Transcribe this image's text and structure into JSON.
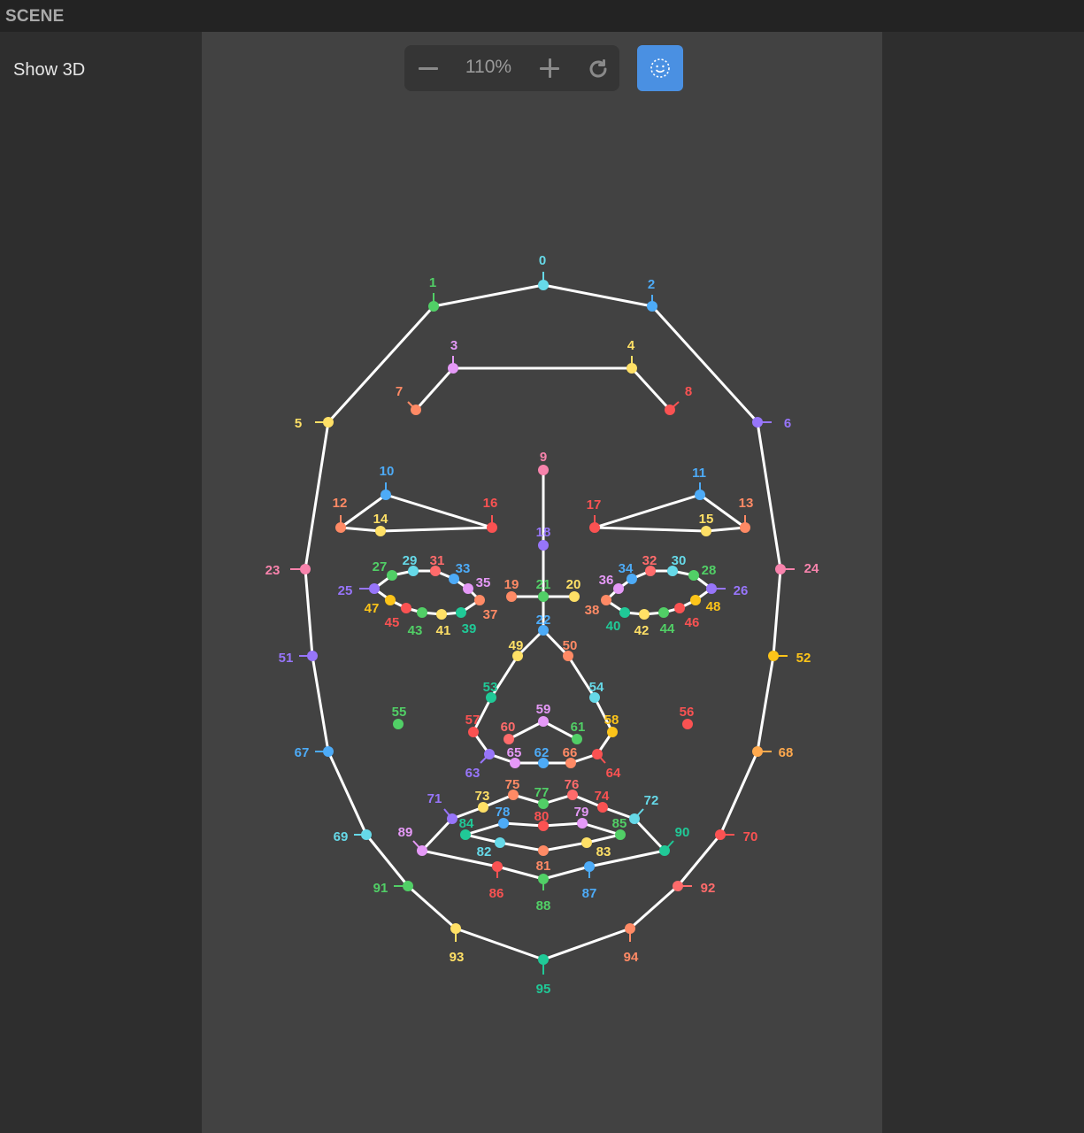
{
  "header": {
    "title": "SCENE"
  },
  "sidebar": {
    "toggle_label": "Show 3D"
  },
  "toolbar": {
    "zoom_value": "110%",
    "zoom_out_icon": "minus-icon",
    "zoom_in_icon": "plus-icon",
    "reset_icon": "rotate-icon",
    "face_button_icon": "face-dotted-icon",
    "face_button_color": "#4a90e2"
  },
  "landmarks": {
    "line_color": "#ffffff",
    "points": [
      {
        "id": "0",
        "c": "#66d9e8"
      },
      {
        "id": "1",
        "c": "#51cf66"
      },
      {
        "id": "2",
        "c": "#4dabf7"
      },
      {
        "id": "3",
        "c": "#e599f7"
      },
      {
        "id": "4",
        "c": "#ffe066"
      },
      {
        "id": "5",
        "c": "#ffe066"
      },
      {
        "id": "6",
        "c": "#9775fa"
      },
      {
        "id": "7",
        "c": "#ff8a65"
      },
      {
        "id": "8",
        "c": "#fa5252"
      },
      {
        "id": "9",
        "c": "#f783ac"
      },
      {
        "id": "10",
        "c": "#4dabf7"
      },
      {
        "id": "11",
        "c": "#4dabf7"
      },
      {
        "id": "12",
        "c": "#ff8a65"
      },
      {
        "id": "13",
        "c": "#ff8a65"
      },
      {
        "id": "14",
        "c": "#ffe066"
      },
      {
        "id": "15",
        "c": "#ffe066"
      },
      {
        "id": "16",
        "c": "#fa5252"
      },
      {
        "id": "17",
        "c": "#fa5252"
      },
      {
        "id": "18",
        "c": "#9775fa"
      },
      {
        "id": "19",
        "c": "#ff8a65"
      },
      {
        "id": "20",
        "c": "#ffe066"
      },
      {
        "id": "21",
        "c": "#51cf66"
      },
      {
        "id": "22",
        "c": "#4dabf7"
      },
      {
        "id": "23",
        "c": "#f783ac"
      },
      {
        "id": "24",
        "c": "#f783ac"
      },
      {
        "id": "25",
        "c": "#9775fa"
      },
      {
        "id": "26",
        "c": "#9775fa"
      },
      {
        "id": "27",
        "c": "#51cf66"
      },
      {
        "id": "28",
        "c": "#51cf66"
      },
      {
        "id": "29",
        "c": "#66d9e8"
      },
      {
        "id": "30",
        "c": "#66d9e8"
      },
      {
        "id": "31",
        "c": "#ff6b6b"
      },
      {
        "id": "32",
        "c": "#ff6b6b"
      },
      {
        "id": "33",
        "c": "#4dabf7"
      },
      {
        "id": "34",
        "c": "#4dabf7"
      },
      {
        "id": "35",
        "c": "#e599f7"
      },
      {
        "id": "36",
        "c": "#e599f7"
      },
      {
        "id": "37",
        "c": "#ff8a65"
      },
      {
        "id": "38",
        "c": "#ff8a65"
      },
      {
        "id": "39",
        "c": "#20c997"
      },
      {
        "id": "40",
        "c": "#20c997"
      },
      {
        "id": "41",
        "c": "#ffe066"
      },
      {
        "id": "42",
        "c": "#ffe066"
      },
      {
        "id": "43",
        "c": "#51cf66"
      },
      {
        "id": "44",
        "c": "#51cf66"
      },
      {
        "id": "45",
        "c": "#fa5252"
      },
      {
        "id": "46",
        "c": "#fa5252"
      },
      {
        "id": "47",
        "c": "#fcc419"
      },
      {
        "id": "48",
        "c": "#fcc419"
      },
      {
        "id": "49",
        "c": "#ffe066"
      },
      {
        "id": "50",
        "c": "#ff8a65"
      },
      {
        "id": "51",
        "c": "#9775fa"
      },
      {
        "id": "52",
        "c": "#fcc419"
      },
      {
        "id": "53",
        "c": "#20c997"
      },
      {
        "id": "54",
        "c": "#66d9e8"
      },
      {
        "id": "55",
        "c": "#51cf66"
      },
      {
        "id": "56",
        "c": "#fa5252"
      },
      {
        "id": "57",
        "c": "#fa5252"
      },
      {
        "id": "58",
        "c": "#fcc419"
      },
      {
        "id": "59",
        "c": "#e599f7"
      },
      {
        "id": "60",
        "c": "#ff6b6b"
      },
      {
        "id": "61",
        "c": "#51cf66"
      },
      {
        "id": "62",
        "c": "#4dabf7"
      },
      {
        "id": "63",
        "c": "#9775fa"
      },
      {
        "id": "64",
        "c": "#fa5252"
      },
      {
        "id": "65",
        "c": "#e599f7"
      },
      {
        "id": "66",
        "c": "#ff8a65"
      },
      {
        "id": "67",
        "c": "#4dabf7"
      },
      {
        "id": "68",
        "c": "#ffa94d"
      },
      {
        "id": "69",
        "c": "#66d9e8"
      },
      {
        "id": "70",
        "c": "#fa5252"
      },
      {
        "id": "71",
        "c": "#9775fa"
      },
      {
        "id": "72",
        "c": "#66d9e8"
      },
      {
        "id": "73",
        "c": "#ffe066"
      },
      {
        "id": "74",
        "c": "#fa5252"
      },
      {
        "id": "75",
        "c": "#ff8a65"
      },
      {
        "id": "76",
        "c": "#ff6b6b"
      },
      {
        "id": "77",
        "c": "#51cf66"
      },
      {
        "id": "78",
        "c": "#4dabf7"
      },
      {
        "id": "79",
        "c": "#e599f7"
      },
      {
        "id": "80",
        "c": "#fa5252"
      },
      {
        "id": "81",
        "c": "#ff8a65"
      },
      {
        "id": "82",
        "c": "#66d9e8"
      },
      {
        "id": "83",
        "c": "#ffe066"
      },
      {
        "id": "84",
        "c": "#20c997"
      },
      {
        "id": "85",
        "c": "#51cf66"
      },
      {
        "id": "86",
        "c": "#fa5252"
      },
      {
        "id": "87",
        "c": "#4dabf7"
      },
      {
        "id": "88",
        "c": "#51cf66"
      },
      {
        "id": "89",
        "c": "#e599f7"
      },
      {
        "id": "90",
        "c": "#20c997"
      },
      {
        "id": "91",
        "c": "#51cf66"
      },
      {
        "id": "92",
        "c": "#ff6b6b"
      },
      {
        "id": "93",
        "c": "#ffe066"
      },
      {
        "id": "94",
        "c": "#ff8a65"
      },
      {
        "id": "95",
        "c": "#20c997"
      }
    ],
    "edges": [
      [
        5,
        1
      ],
      [
        1,
        0
      ],
      [
        0,
        2
      ],
      [
        2,
        6
      ],
      [
        5,
        23
      ],
      [
        23,
        51
      ],
      [
        51,
        67
      ],
      [
        67,
        69
      ],
      [
        69,
        91
      ],
      [
        91,
        93
      ],
      [
        93,
        95
      ],
      [
        95,
        94
      ],
      [
        94,
        92
      ],
      [
        92,
        70
      ],
      [
        70,
        68
      ],
      [
        68,
        52
      ],
      [
        52,
        24
      ],
      [
        24,
        6
      ],
      [
        7,
        3
      ],
      [
        3,
        4
      ],
      [
        4,
        8
      ],
      [
        12,
        10
      ],
      [
        10,
        16
      ],
      [
        16,
        14
      ],
      [
        14,
        12
      ],
      [
        17,
        11
      ],
      [
        11,
        13
      ],
      [
        13,
        15
      ],
      [
        15,
        17
      ],
      [
        9,
        18
      ],
      [
        18,
        21
      ],
      [
        21,
        22
      ],
      [
        19,
        21
      ],
      [
        21,
        20
      ],
      [
        25,
        27
      ],
      [
        27,
        29
      ],
      [
        29,
        31
      ],
      [
        31,
        33
      ],
      [
        33,
        35
      ],
      [
        35,
        37
      ],
      [
        37,
        39
      ],
      [
        39,
        41
      ],
      [
        41,
        43
      ],
      [
        43,
        45
      ],
      [
        45,
        47
      ],
      [
        47,
        25
      ],
      [
        26,
        28
      ],
      [
        28,
        30
      ],
      [
        30,
        32
      ],
      [
        32,
        34
      ],
      [
        34,
        36
      ],
      [
        36,
        38
      ],
      [
        38,
        40
      ],
      [
        40,
        42
      ],
      [
        42,
        44
      ],
      [
        44,
        46
      ],
      [
        46,
        48
      ],
      [
        48,
        26
      ],
      [
        22,
        49
      ],
      [
        22,
        50
      ],
      [
        49,
        53
      ],
      [
        53,
        57
      ],
      [
        57,
        63
      ],
      [
        63,
        65
      ],
      [
        65,
        62
      ],
      [
        62,
        66
      ],
      [
        66,
        64
      ],
      [
        64,
        58
      ],
      [
        58,
        54
      ],
      [
        54,
        50
      ],
      [
        60,
        59
      ],
      [
        59,
        61
      ],
      [
        89,
        71
      ],
      [
        71,
        73
      ],
      [
        73,
        75
      ],
      [
        75,
        77
      ],
      [
        77,
        76
      ],
      [
        76,
        74
      ],
      [
        74,
        72
      ],
      [
        72,
        90
      ],
      [
        84,
        78
      ],
      [
        78,
        80
      ],
      [
        80,
        79
      ],
      [
        79,
        85
      ],
      [
        84,
        82
      ],
      [
        82,
        81
      ],
      [
        81,
        83
      ],
      [
        83,
        85
      ],
      [
        89,
        86
      ],
      [
        86,
        88
      ],
      [
        88,
        87
      ],
      [
        87,
        90
      ]
    ]
  }
}
